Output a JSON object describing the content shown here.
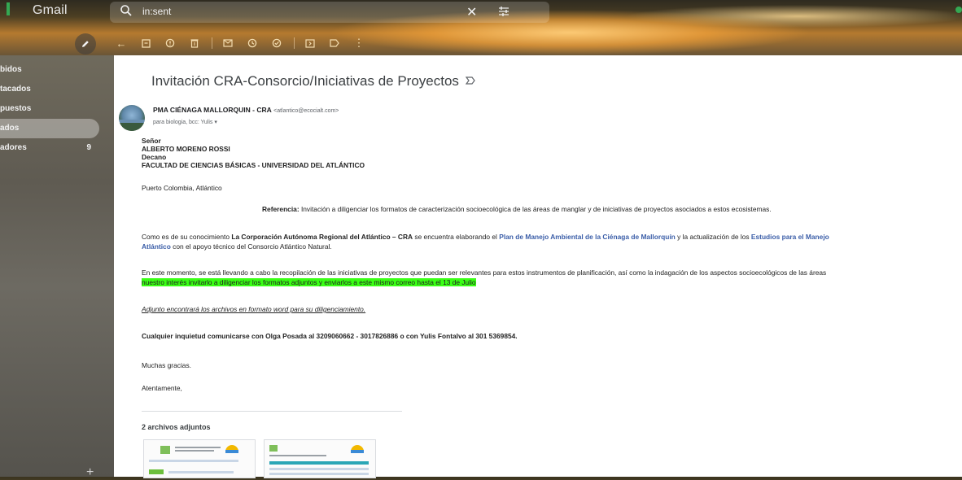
{
  "app": {
    "name": "Gmail"
  },
  "search": {
    "query": "in:sent"
  },
  "sidebar": {
    "items": [
      {
        "label": "bidos"
      },
      {
        "label": "tacados"
      },
      {
        "label": "puestos"
      },
      {
        "label": "ados"
      },
      {
        "label": "adores",
        "count": "9"
      }
    ]
  },
  "toolbar": {
    "icons": [
      "back-arrow-icon",
      "archive-icon",
      "report-spam-icon",
      "delete-icon",
      "mark-unread-icon",
      "snooze-icon",
      "add-to-tasks-icon",
      "move-to-icon",
      "labels-icon",
      "more-icon"
    ]
  },
  "email": {
    "subject": "Invitación CRA-Consorcio/Iniciativas de Proyectos",
    "sender_name": "PMA CIÉNAGA MALLORQUIN - CRA",
    "sender_email": "<atlantico@ecocialt.com>",
    "recipients": "para biologia, bcc: Yulis ▾",
    "salutation": "Señor",
    "recipient_name": "ALBERTO MORENO ROSSI",
    "recipient_title": "Decano",
    "faculty": "FACULTAD DE CIENCIAS BÁSICAS - UNIVERSIDAD DEL ATLÁNTICO",
    "location": "Puerto Colombia, Atlántico",
    "ref_label": "Referencia:",
    "ref_text": " Invitación a diligenciar los formatos de caracterización socioecológica de las áreas de manglar y de iniciativas de proyectos asociados a estos ecosistemas.",
    "p1_a": "Como es de su conocimiento ",
    "p1_b": "La Corporación Autónoma Regional del Atlántico – CRA",
    "p1_c": " se encuentra elaborando el ",
    "p1_d": "Plan de Manejo Ambiental de la Ciénaga de Mallorquín",
    "p1_e": " y la actualización de los ",
    "p1_f": "Estudios para el Manejo",
    "p1_g": "Atlántico",
    "p1_h": " con el apoyo técnico del Consorcio Atlántico Natural.",
    "p2_a": "En este momento, se está llevando a cabo la recopilación de las iniciativas de proyectos que puedan ser relevantes para estos instrumentos de planificación, así como la indagación de los aspectos socioecológicos de las áreas",
    "p2_b": "nuestro interés invitarlo a diligenciar los formatos adjuntos y enviarlos a este mismo correo hasta el 13 de Julio",
    "p3": "Adjunto encontrará los archivos en formato word para su diligenciamiento.",
    "p4": "Cualquier inquietud comunicarse con Olga Posada  al 3209060662 - 3017826886 o con Yulis Fontalvo al 301 5369854.",
    "thanks": "Muchas gracias.",
    "closing": "Atentamente,",
    "attachments_title": "2 archivos adjuntos"
  },
  "colors": {
    "link": "#3b5ea8",
    "highlight": "#39ff14",
    "gmail_green": "#34a853"
  }
}
